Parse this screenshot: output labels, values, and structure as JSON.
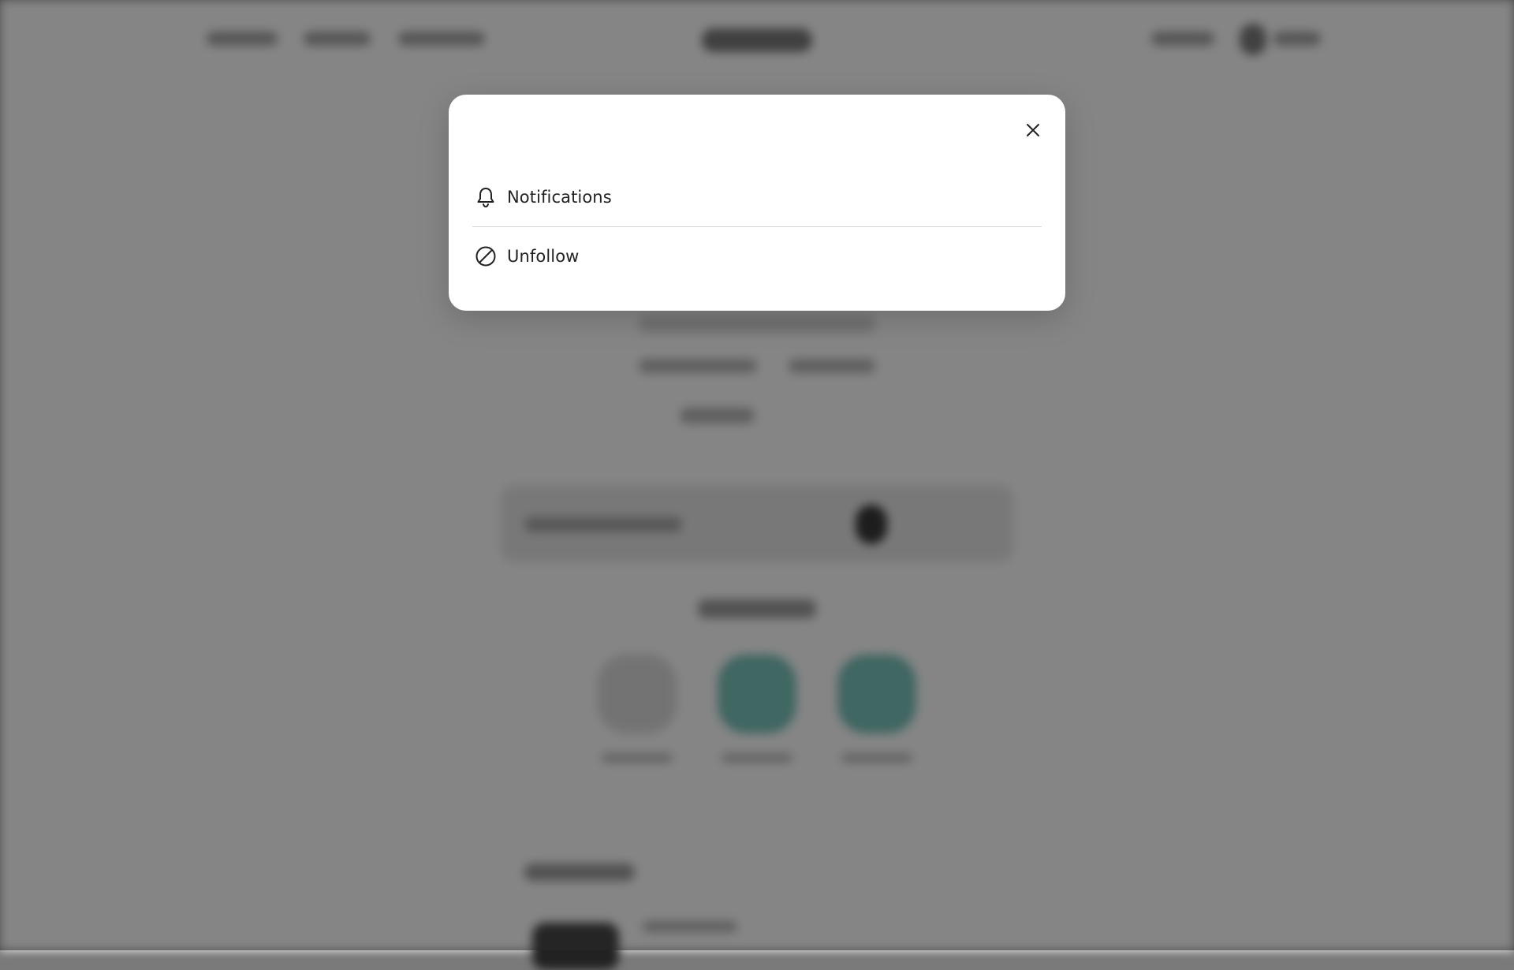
{
  "modal": {
    "close_icon": "close-icon",
    "items": [
      {
        "label": "Notifications",
        "icon": "bell-icon"
      },
      {
        "label": "Unfollow",
        "icon": "block-icon"
      }
    ]
  },
  "colors": {
    "overlay": "#7a7a7a",
    "modal_background": "#ffffff",
    "text": "#222222",
    "divider": "#d6d6d6",
    "teal_accent": "#5fb3aa"
  }
}
